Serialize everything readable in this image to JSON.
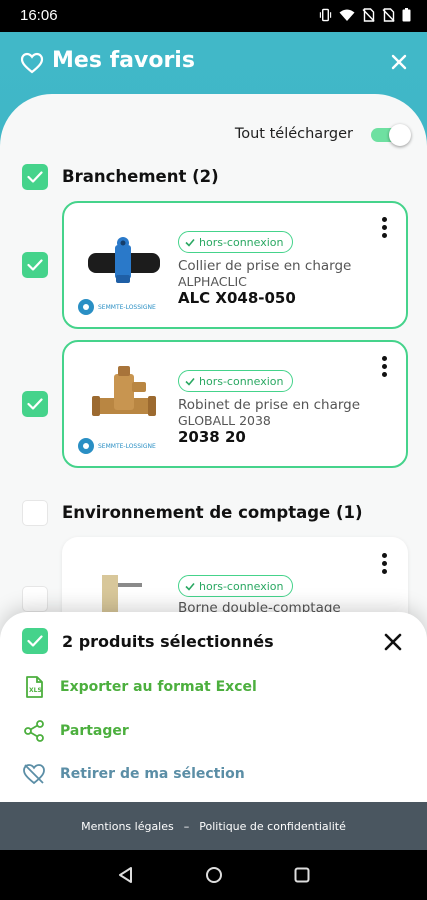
{
  "status_bar": {
    "time": "16:06"
  },
  "header": {
    "title": "Mes favoris"
  },
  "download_all": {
    "label": "Tout télécharger",
    "enabled": true
  },
  "colors": {
    "teal": "#41b8c8",
    "green": "#45d38b",
    "dark_green": "#2aa862",
    "blue_grey": "#5b8ea6",
    "footer": "#4a5660"
  },
  "sections": [
    {
      "title": "Branchement (2)",
      "checked": true,
      "products": [
        {
          "checked": true,
          "badge": "hors-connexion",
          "type": "Collier de prise en charge",
          "line": "ALPHACLIC",
          "reference": "ALC X048-050",
          "brand": "SEMMTE-LOSSIGNE"
        },
        {
          "checked": true,
          "badge": "hors-connexion",
          "type": "Robinet de prise en charge",
          "line": "GLOBALL 2038",
          "reference": "2038 20",
          "brand": "SEMMTE-LOSSIGNE"
        }
      ]
    },
    {
      "title": "Environnement de comptage (1)",
      "checked": false,
      "products": [
        {
          "checked": false,
          "badge": "hors-connexion",
          "type": "Borne double-comptage"
        }
      ]
    }
  ],
  "selection_sheet": {
    "title": "2 produits sélectionnés",
    "actions": [
      {
        "label": "Exporter au format Excel",
        "icon": "excel-file-icon",
        "color": "#4caf3e"
      },
      {
        "label": "Partager",
        "icon": "share-icon",
        "color": "#4caf3e"
      },
      {
        "label": "Retirer de ma sélection",
        "icon": "heart-remove-icon",
        "color": "#5b8ea6"
      }
    ]
  },
  "footer": {
    "legal": "Mentions légales",
    "separator": "–",
    "privacy": "Politique de confidentialité"
  }
}
